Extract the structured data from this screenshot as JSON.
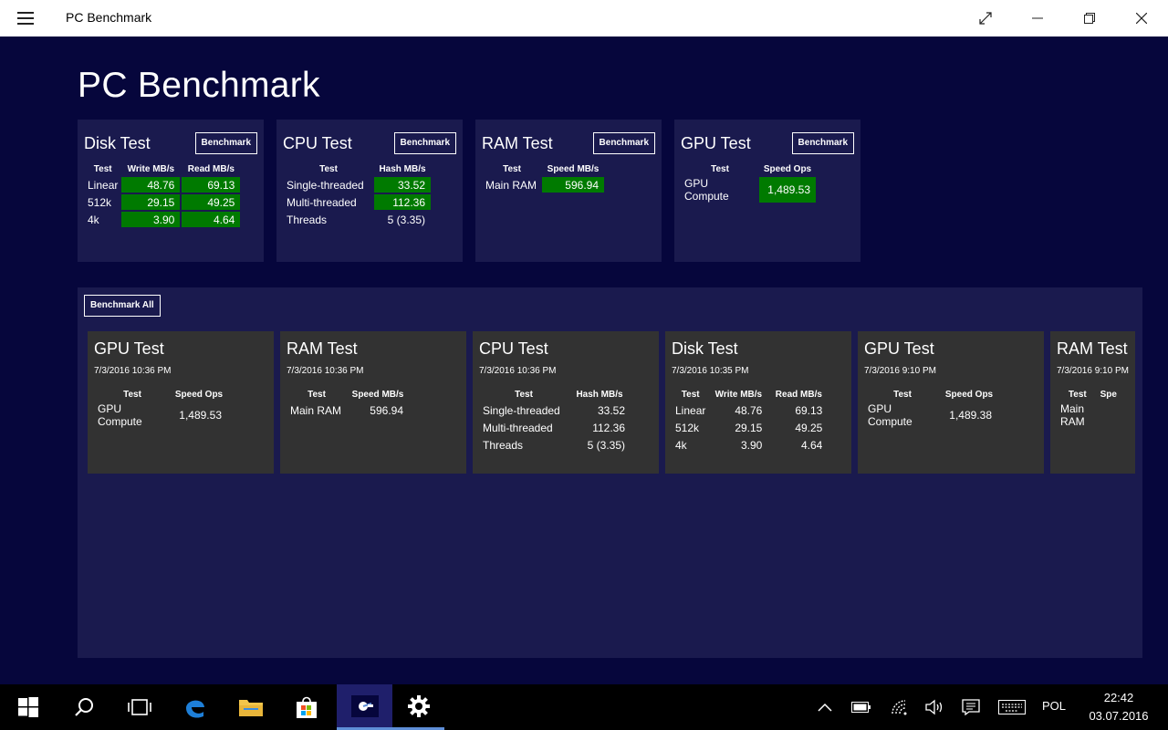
{
  "window": {
    "title": "PC Benchmark"
  },
  "page_title": "PC Benchmark",
  "benchmark_label": "Benchmark",
  "benchmark_all_label": "Benchmark All",
  "tests": {
    "disk": {
      "title": "Disk Test",
      "headers": [
        "Test",
        "Write MB/s",
        "Read MB/s"
      ],
      "rows": [
        [
          "Linear",
          "48.76",
          "69.13"
        ],
        [
          "512k",
          "29.15",
          "49.25"
        ],
        [
          "4k",
          "3.90",
          "4.64"
        ]
      ]
    },
    "cpu": {
      "title": "CPU Test",
      "headers": [
        "Test",
        "Hash MB/s"
      ],
      "rows": [
        [
          "Single-threaded",
          "33.52"
        ],
        [
          "Multi-threaded",
          "112.36"
        ],
        [
          "Threads",
          "5 (3.35)"
        ]
      ]
    },
    "ram": {
      "title": "RAM Test",
      "headers": [
        "Test",
        "Speed MB/s"
      ],
      "rows": [
        [
          "Main RAM",
          "596.94"
        ]
      ]
    },
    "gpu": {
      "title": "GPU Test",
      "headers": [
        "Test",
        "Speed Ops"
      ],
      "rows": [
        [
          "GPU Compute",
          "1,489.53"
        ]
      ]
    }
  },
  "history": [
    {
      "title": "GPU Test",
      "date": "7/3/2016 10:36 PM",
      "headers": [
        "Test",
        "Speed Ops"
      ],
      "rows": [
        [
          "GPU Compute",
          "1,489.53"
        ]
      ]
    },
    {
      "title": "RAM Test",
      "date": "7/3/2016 10:36 PM",
      "headers": [
        "Test",
        "Speed MB/s"
      ],
      "rows": [
        [
          "Main RAM",
          "596.94"
        ]
      ]
    },
    {
      "title": "CPU Test",
      "date": "7/3/2016 10:36 PM",
      "headers": [
        "Test",
        "Hash MB/s"
      ],
      "rows": [
        [
          "Single-threaded",
          "33.52"
        ],
        [
          "Multi-threaded",
          "112.36"
        ],
        [
          "Threads",
          "5 (3.35)"
        ]
      ]
    },
    {
      "title": "Disk Test",
      "date": "7/3/2016 10:35 PM",
      "headers": [
        "Test",
        "Write MB/s",
        "Read MB/s"
      ],
      "rows": [
        [
          "Linear",
          "48.76",
          "69.13"
        ],
        [
          "512k",
          "29.15",
          "49.25"
        ],
        [
          "4k",
          "3.90",
          "4.64"
        ]
      ]
    },
    {
      "title": "GPU Test",
      "date": "7/3/2016 9:10 PM",
      "headers": [
        "Test",
        "Speed Ops"
      ],
      "rows": [
        [
          "GPU Compute",
          "1,489.38"
        ]
      ]
    },
    {
      "title": "RAM Test",
      "date": "7/3/2016 9:10 PM",
      "headers": [
        "Test",
        "Spe"
      ],
      "rows": [
        [
          "Main RAM",
          ""
        ]
      ]
    }
  ],
  "taskbar": {
    "language": "POL",
    "time": "22:42",
    "date": "03.07.2016"
  },
  "colors": {
    "background": "#06063c",
    "panel": "#1a1a4e",
    "history_card": "#323232",
    "highlight": "#007a00",
    "taskbar": "#000000"
  }
}
